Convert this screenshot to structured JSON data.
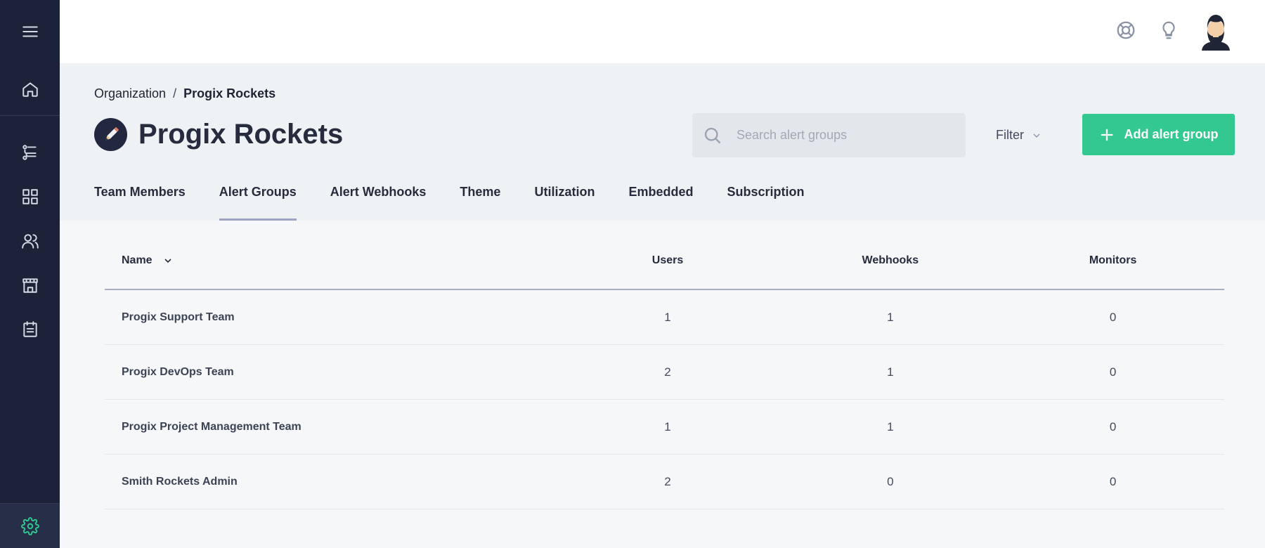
{
  "breadcrumb": {
    "parent": "Organization",
    "separator": "/",
    "current": "Progix Rockets"
  },
  "page": {
    "title": "Progix Rockets"
  },
  "search": {
    "placeholder": "Search alert groups"
  },
  "filter": {
    "label": "Filter"
  },
  "add_button": {
    "label": "Add alert group"
  },
  "tabs": [
    {
      "label": "Team Members",
      "active": false
    },
    {
      "label": "Alert Groups",
      "active": true
    },
    {
      "label": "Alert Webhooks",
      "active": false
    },
    {
      "label": "Theme",
      "active": false
    },
    {
      "label": "Utilization",
      "active": false
    },
    {
      "label": "Embedded",
      "active": false
    },
    {
      "label": "Subscription",
      "active": false
    }
  ],
  "table": {
    "columns": [
      "Name",
      "Users",
      "Webhooks",
      "Monitors"
    ],
    "rows": [
      {
        "name": "Progix Support Team",
        "users": "1",
        "webhooks": "1",
        "monitors": "0"
      },
      {
        "name": "Progix DevOps Team",
        "users": "2",
        "webhooks": "1",
        "monitors": "0"
      },
      {
        "name": "Progix Project Management Team",
        "users": "1",
        "webhooks": "1",
        "monitors": "0"
      },
      {
        "name": "Smith Rockets Admin",
        "users": "2",
        "webhooks": "0",
        "monitors": "0"
      }
    ]
  },
  "icons": {
    "sidebar": [
      "menu-icon",
      "home-icon",
      "flow-icon",
      "grid-icon",
      "users-icon",
      "store-icon",
      "clipboard-icon",
      "settings-icon"
    ],
    "header": [
      "help-icon",
      "lightbulb-icon",
      "avatar"
    ]
  },
  "colors": {
    "sidebar_bg": "#1c2238",
    "accent": "#32c88f",
    "tab_indicator": "#9ea5c4"
  }
}
